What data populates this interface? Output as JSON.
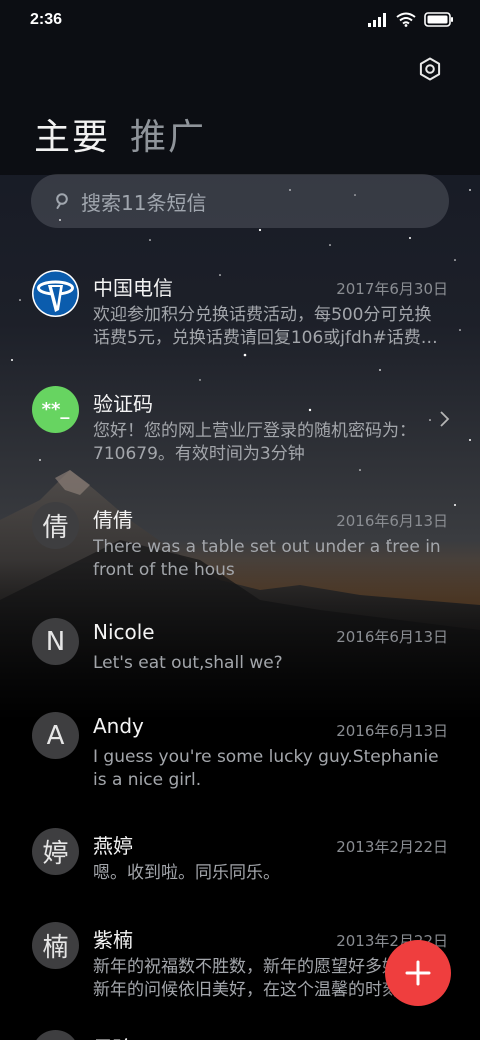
{
  "status": {
    "time": "2:36"
  },
  "tabs": [
    {
      "label": "主要"
    },
    {
      "label": "推广"
    }
  ],
  "search": {
    "placeholder": "搜索11条短信"
  },
  "conversations": [
    {
      "avatar_type": "telecom-logo",
      "name": "中国电信",
      "date": "2017年6月30日",
      "preview_lines": [
        "欢迎参加积分兑换话费活动，每500分可兑换",
        "话费5元，兑换话费请回复106或jfdh#话费…"
      ]
    },
    {
      "avatar_text": "**_",
      "avatar_type": "green",
      "name": "验证码",
      "date": "",
      "preview_lines": [
        "您好！您的网上营业厅登录的随机密码为：",
        "710679。有效时间为3分钟"
      ],
      "has_chevron": true
    },
    {
      "avatar_text": "倩",
      "name": "倩倩",
      "date": "2016年6月13日",
      "preview_lines": [
        "There was a table set out under a tree in",
        "front of the hous"
      ]
    },
    {
      "avatar_text": "N",
      "name": "Nicole",
      "date": "2016年6月13日",
      "preview_lines": [
        "Let's eat out,shall we?"
      ]
    },
    {
      "avatar_text": "A",
      "name": "Andy",
      "date": "2016年6月13日",
      "preview_lines": [
        "I guess you're some lucky guy.Stephanie",
        "is a nice girl."
      ]
    },
    {
      "avatar_text": "婷",
      "name": "燕婷",
      "date": "2013年2月22日",
      "preview_lines": [
        "嗯。收到啦。同乐同乐。"
      ]
    },
    {
      "avatar_text": "楠",
      "name": "紫楠",
      "date": "2013年2月22日",
      "preview_lines": [
        "新年的祝福数不胜数，新年的愿望好多好多，",
        "新年的问候依旧美好，在这个温馨的时刻"
      ]
    },
    {
      "avatar_text": "",
      "name": "子玲",
      "date": "",
      "preview_lines": []
    }
  ],
  "icons": {
    "settings": "gear-icon",
    "search": "search-icon",
    "compose": "plus-icon"
  },
  "colors": {
    "fab": "#ef3e3e",
    "verification_avatar": "#67d461",
    "telecom_blue": "#0b5cad"
  }
}
